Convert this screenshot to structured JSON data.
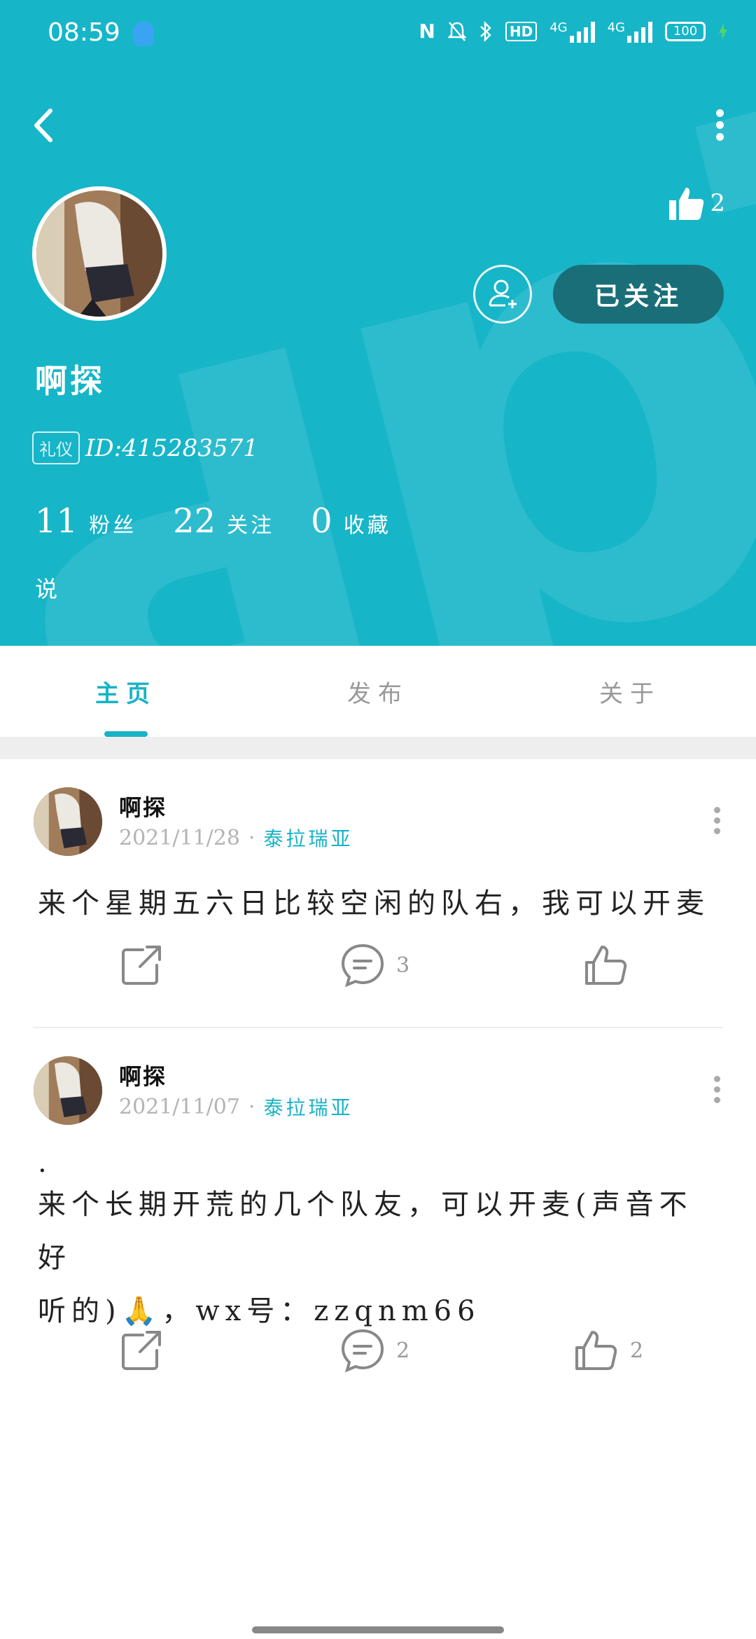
{
  "status_bar": {
    "time": "08:59",
    "nfc": "N",
    "hd": "HD",
    "net1": "4G",
    "net2": "4G",
    "battery": "100"
  },
  "header": {
    "like_count": "2",
    "follow_label": "已关注",
    "username": "啊探",
    "badge": "礼仪",
    "user_id": "ID:415283571",
    "stats": [
      {
        "num": "11",
        "label": "粉丝"
      },
      {
        "num": "22",
        "label": "关注"
      },
      {
        "num": "0",
        "label": "收藏"
      }
    ],
    "signature": "说",
    "accent_color": "#16b5c8"
  },
  "tabs": [
    {
      "label": "主页",
      "active": true
    },
    {
      "label": "发布",
      "active": false
    },
    {
      "label": "关于",
      "active": false
    }
  ],
  "posts": [
    {
      "author": "啊探",
      "date": "2021/11/28",
      "sep": "·",
      "location": "泰拉瑞亚",
      "text_lines": [
        "来个星期五六日比较空闲的队右，我可以开麦"
      ],
      "comment_count": "3",
      "like_count": ""
    },
    {
      "author": "啊探",
      "date": "2021/11/07",
      "sep": "·",
      "location": "泰拉瑞亚",
      "text_lines": [
        ".",
        "来个长期开荒的几个队友，可以开麦(声音不好",
        "听的)🙏，wx号：zzqnm66"
      ],
      "comment_count": "2",
      "like_count": "2"
    }
  ]
}
